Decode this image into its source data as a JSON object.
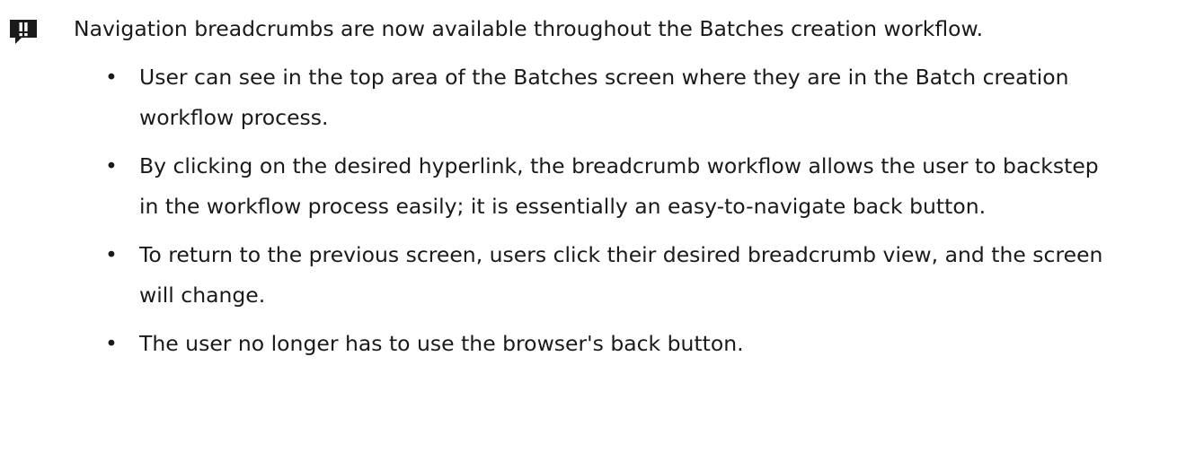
{
  "note": {
    "icon": "exclamation-speech-bubble-icon",
    "icon_color": "#1a1a1a",
    "headline": "Navigation breadcrumbs are now available throughout the Batches creation workflow.",
    "bullet_glyph": "•",
    "bullets": [
      "User can see in the top area of the Batches screen where they are in the Batch creation workflow process.",
      "By clicking on the desired hyperlink, the breadcrumb workflow allows the user to backstep in the workflow process easily; it is essentially an easy-to-navigate back button.",
      "To return to the previous screen, users click their desired breadcrumb view, and the screen will change.",
      "The user no longer has to use the browser's back button."
    ]
  }
}
